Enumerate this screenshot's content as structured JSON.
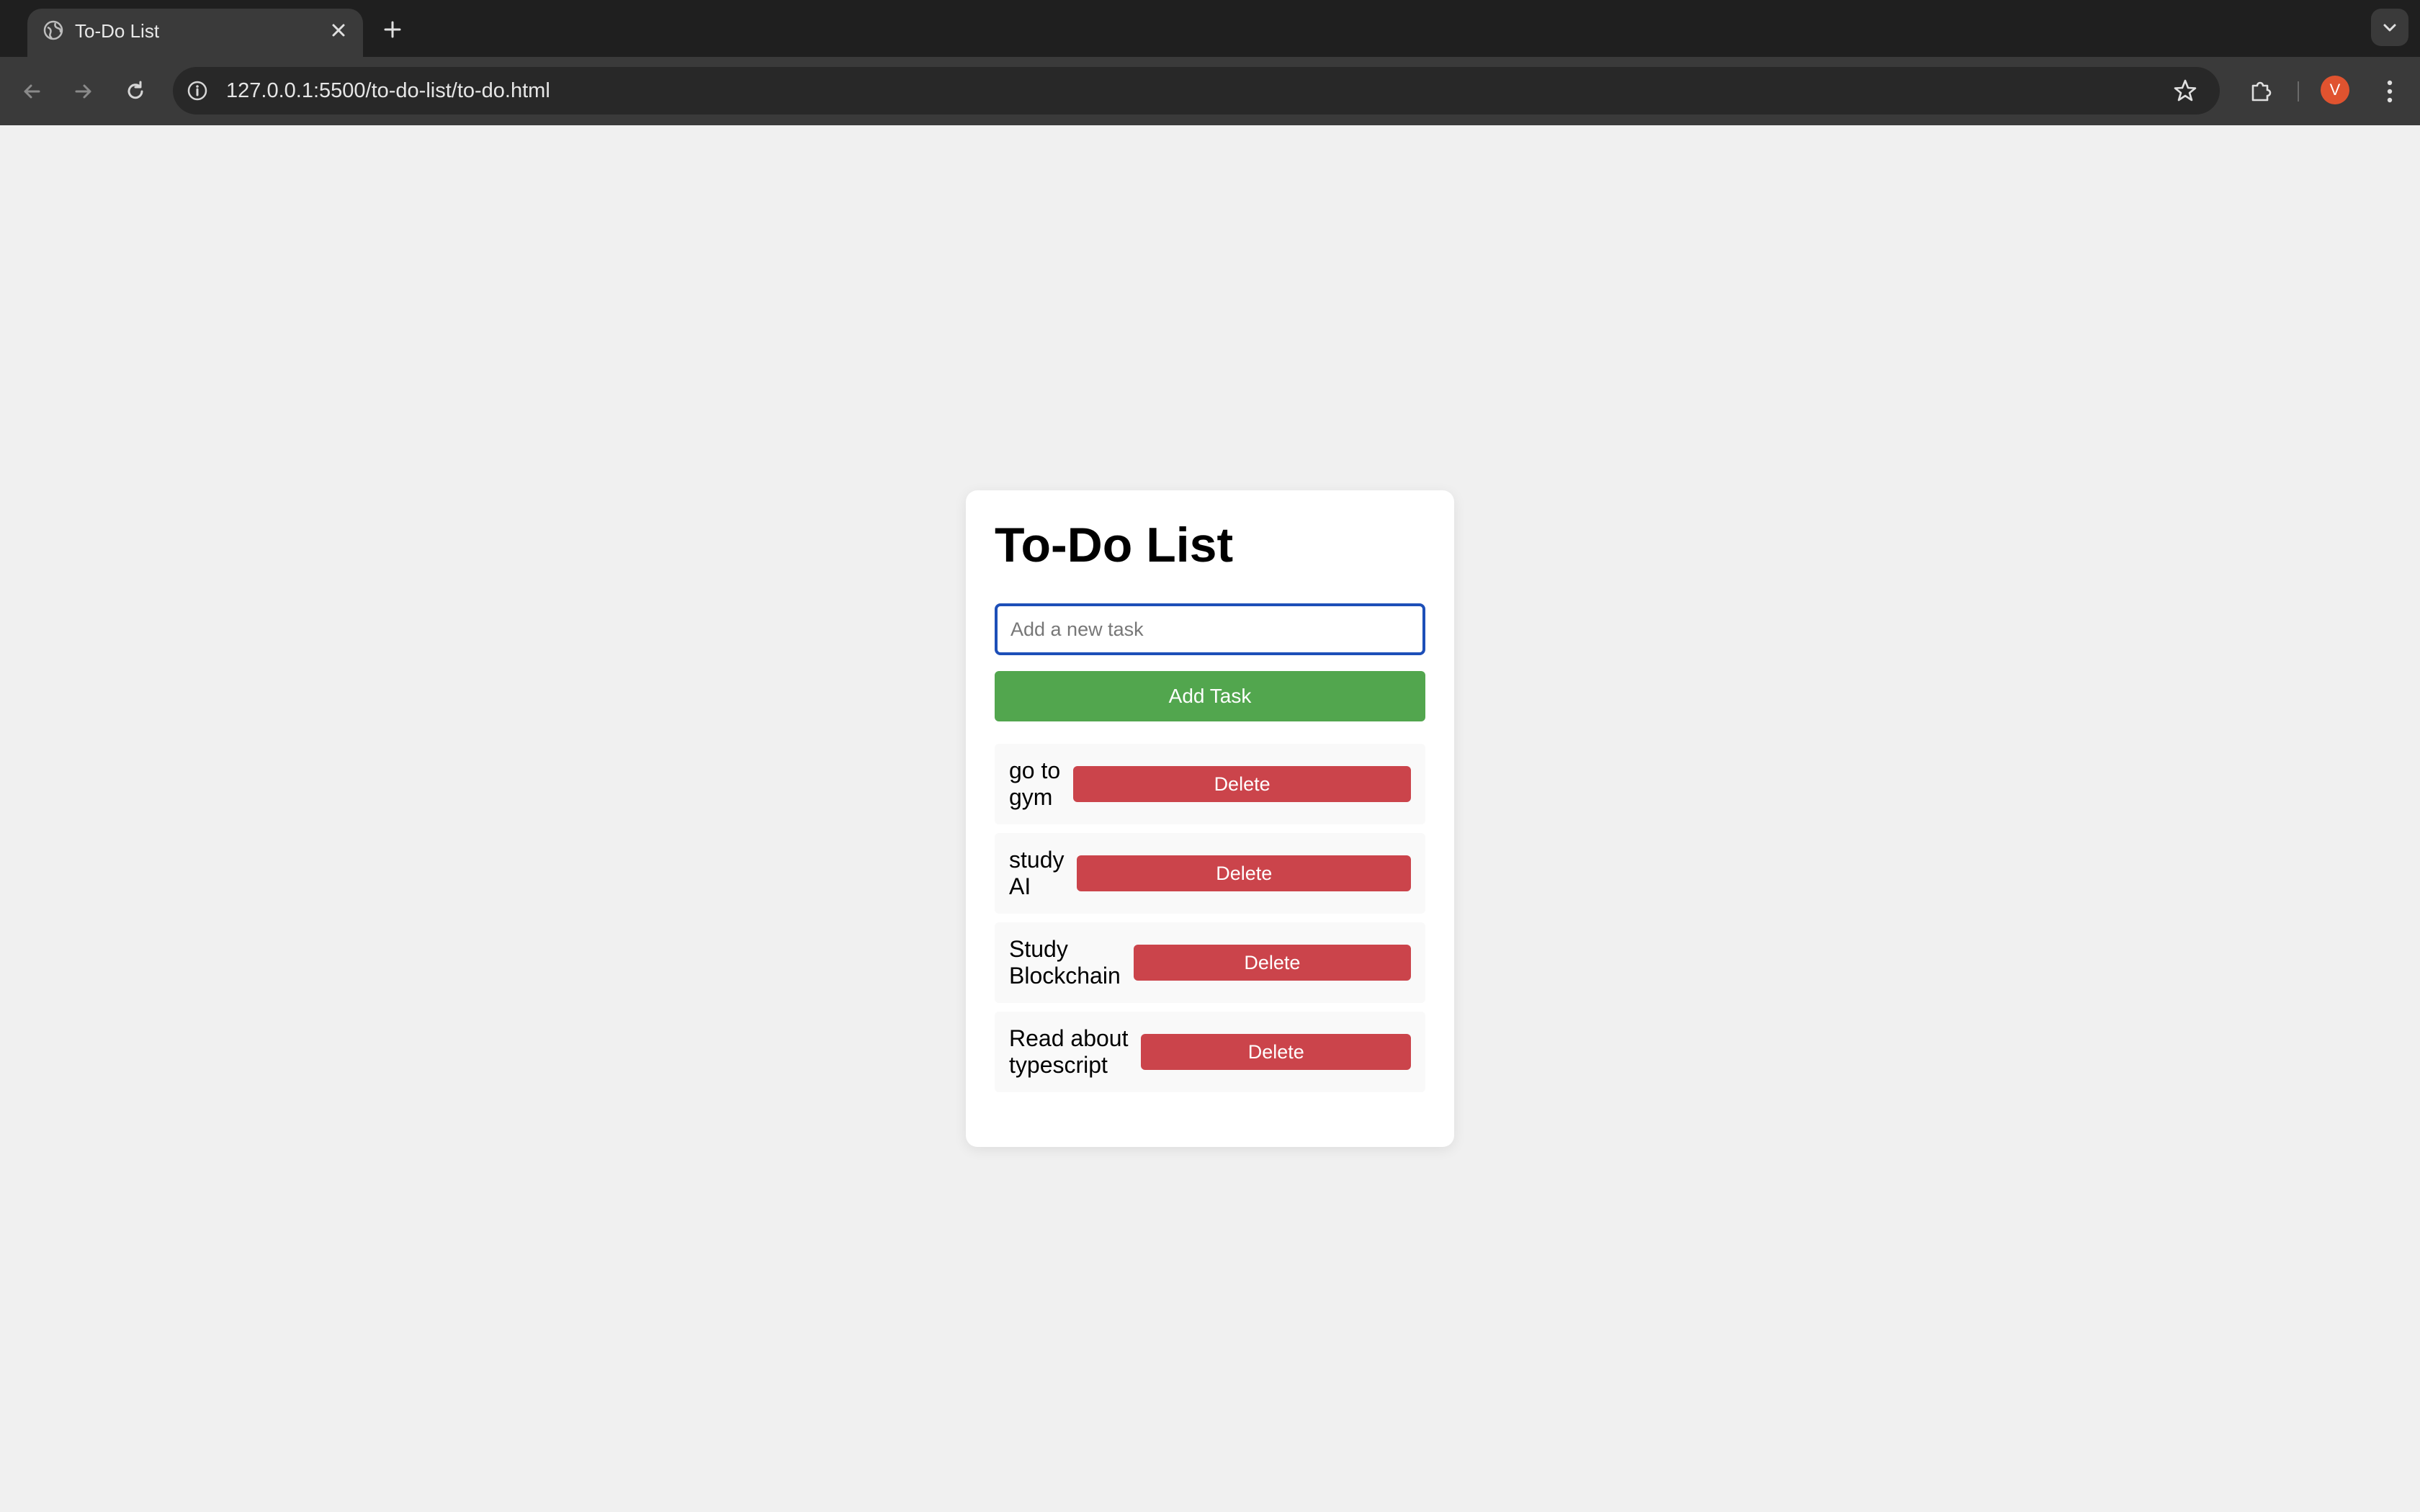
{
  "browser": {
    "tab_title": "To-Do List",
    "url": "127.0.0.1:5500/to-do-list/to-do.html",
    "avatar_letter": "V"
  },
  "app": {
    "title": "To-Do List",
    "input_placeholder": "Add a new task",
    "input_value": "",
    "add_label": "Add Task",
    "tasks": [
      {
        "text": "go to\ngym",
        "delete_label": "Delete"
      },
      {
        "text": "study\nAI",
        "delete_label": "Delete"
      },
      {
        "text": "Study\nBlockchain",
        "delete_label": "Delete"
      },
      {
        "text": "Read about\ntypescript",
        "delete_label": "Delete"
      }
    ]
  },
  "colors": {
    "add_button": "#52a64e",
    "delete_button": "#cb444b",
    "input_focus_border": "#1d4fb8",
    "page_background": "#f0f0f0"
  }
}
